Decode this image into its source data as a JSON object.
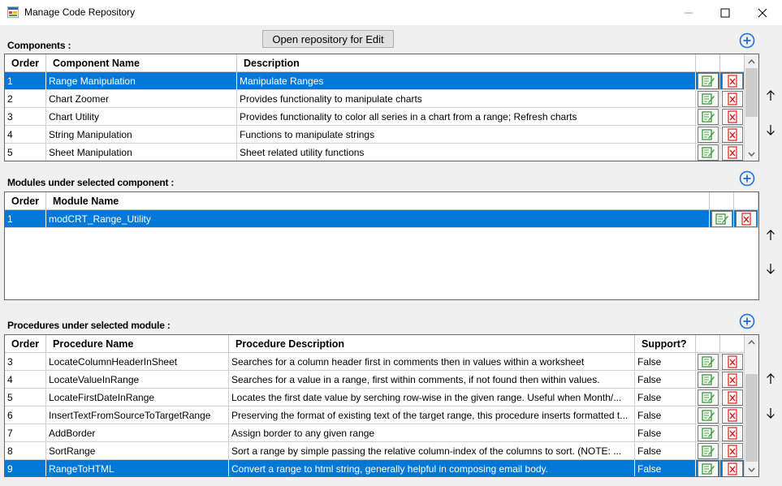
{
  "window": {
    "title": "Manage Code Repository"
  },
  "toolbar": {
    "open_label": "Open repository for Edit"
  },
  "components": {
    "label": "Components :",
    "headers": {
      "order": "Order",
      "name": "Component Name",
      "desc": "Description"
    },
    "rows": [
      {
        "order": "1",
        "name": "Range Manipulation",
        "desc": "Manipulate Ranges",
        "selected": true
      },
      {
        "order": "2",
        "name": "Chart Zoomer",
        "desc": "Provides functionality to manipulate charts",
        "selected": false
      },
      {
        "order": "3",
        "name": "Chart Utility",
        "desc": "Provides functionality to color all series in a chart from a range; Refresh charts",
        "selected": false
      },
      {
        "order": "4",
        "name": "String Manipulation",
        "desc": "Functions to manipulate strings",
        "selected": false
      },
      {
        "order": "5",
        "name": "Sheet Manipulation",
        "desc": "Sheet related utility functions",
        "selected": false
      }
    ]
  },
  "modules": {
    "label": "Modules under selected component :",
    "headers": {
      "order": "Order",
      "name": "Module Name"
    },
    "rows": [
      {
        "order": "1",
        "name": "modCRT_Range_Utility",
        "selected": true
      }
    ]
  },
  "procedures": {
    "label": "Procedures under selected module :",
    "headers": {
      "order": "Order",
      "name": "Procedure Name",
      "desc": "Procedure Description",
      "support": "Support?"
    },
    "rows": [
      {
        "order": "3",
        "name": "LocateColumnHeaderInSheet",
        "desc": "Searches for a column header first in comments then in values within a worksheet",
        "support": "False",
        "selected": false
      },
      {
        "order": "4",
        "name": "LocateValueInRange",
        "desc": "Searches for a value in a range, first within comments, if not found then within values.",
        "support": "False",
        "selected": false
      },
      {
        "order": "5",
        "name": "LocateFirstDateInRange",
        "desc": "Locates the first date value by serching row-wise in the given range. Useful when Month/...",
        "support": "False",
        "selected": false
      },
      {
        "order": "6",
        "name": "InsertTextFromSourceToTargetRange",
        "desc": "Preserving the format of existing text of the target range, this procedure inserts formatted t...",
        "support": "False",
        "selected": false
      },
      {
        "order": "7",
        "name": "AddBorder",
        "desc": "Assign border to any given range",
        "support": "False",
        "selected": false
      },
      {
        "order": "8",
        "name": "SortRange",
        "desc": "Sort a range by simple passing the relative column-index of the columns to sort. (NOTE: ...",
        "support": "False",
        "selected": false
      },
      {
        "order": "9",
        "name": "RangeToHTML",
        "desc": "Convert a range to html string, generally helpful in composing email body.",
        "support": "False",
        "selected": true
      }
    ]
  },
  "icons": {
    "edit": "edit-icon",
    "delete": "delete-icon",
    "add": "add-circle-icon",
    "up": "arrow-up-icon",
    "down": "arrow-down-icon"
  },
  "colors": {
    "selection": "#0078d7",
    "add": "#1e6fd9",
    "edit": "#3aa53a",
    "delete": "#d82020"
  }
}
